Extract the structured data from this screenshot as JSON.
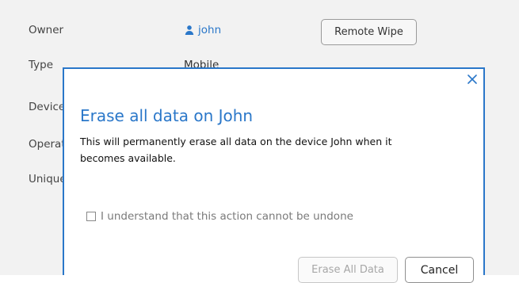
{
  "background": {
    "rows": [
      {
        "label": "Owner"
      },
      {
        "label": "Type"
      },
      {
        "label": "Device"
      },
      {
        "label": "Operat"
      },
      {
        "label": "Unique"
      }
    ],
    "owner": {
      "value": "john",
      "icon": "user-icon"
    },
    "type": {
      "value": "Mobile"
    },
    "remote_wipe_label": "Remote Wipe"
  },
  "modal": {
    "title": "Erase all data on John",
    "body": "This will permanently erase all data on the device John when it becomes available.",
    "checkbox_label": "I understand that this action cannot be undone",
    "erase_button_label": "Erase All Data",
    "cancel_button_label": "Cancel",
    "close_icon": "close-icon"
  },
  "colors": {
    "accent": "#2a77c9",
    "background": "#f2f2f2"
  }
}
